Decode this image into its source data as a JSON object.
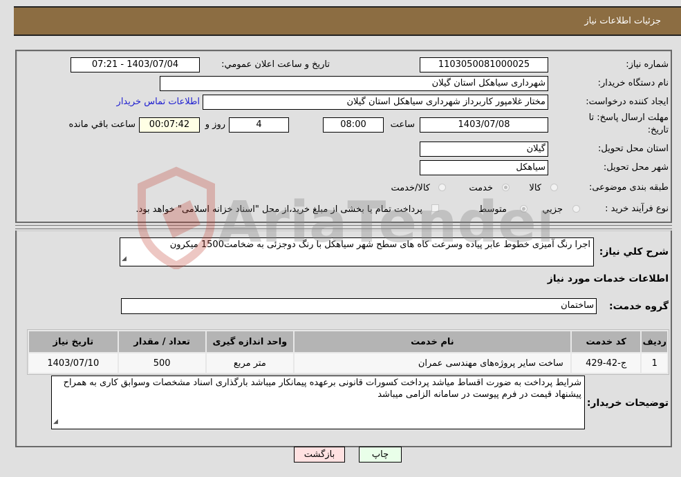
{
  "header": {
    "title": "جزئيات اطلاعات نیاز"
  },
  "fields": {
    "need_number": {
      "label": "شماره نیاز:",
      "value": "1103050081000025"
    },
    "announce_datetime": {
      "label": "تاریخ و ساعت اعلان عمومي:",
      "value": "1403/07/04 - 07:21"
    },
    "buyer_org": {
      "label": "نام دستگاه خریدار:",
      "value": "شهرداری سیاهکل استان گیلان"
    },
    "requester": {
      "label": "ایجاد کننده درخواست:",
      "value": "مختار غلامپور کاربرداز شهرداری سیاهکل استان گیلان"
    },
    "buyer_contact_link": "اطلاعات تماس خریدار",
    "deadline": {
      "label_line1": "مهلت ارسال پاسخ: تا",
      "label_line2": "تاریخ:",
      "date": "1403/07/08",
      "time_label": "ساعت",
      "time": "08:00",
      "days": "4",
      "days_label": "روز و",
      "remaining": "00:07:42",
      "remaining_label": "ساعت باقي مانده"
    },
    "delivery_province": {
      "label": "استان محل تحویل:",
      "value": "گیلان"
    },
    "delivery_city": {
      "label": "شهر محل تحویل:",
      "value": "سیاهکل"
    },
    "category": {
      "label": "طبقه بندی موضوعی:",
      "options": [
        "کالا",
        "خدمت",
        "کالا/خدمت"
      ],
      "selected": "خدمت"
    },
    "purchase_type": {
      "label": "نوع فرآیند خرید :",
      "options": [
        "جزيي",
        "متوسط"
      ],
      "selected": "متوسط",
      "treasury_note": "پرداخت تمام یا بخشی از مبلغ خرید،از محل \"اسناد خزانه اسلامی\" خواهد بود."
    }
  },
  "description": {
    "label": "شرح كلي نياز:",
    "value": "اجرا رنگ آمیزی خطوط عابر پیاده وسرعت کاه های سطح شهر سیاهکل  با رنگ دوجزئی به ضخامت1500 میکرون"
  },
  "services_section": {
    "title": "اطلاعات خدمات مورد نياز",
    "service_group": {
      "label": "گروه خدمت:",
      "value": "ساختمان"
    },
    "table": {
      "headers": [
        "ردیف",
        "کد خدمت",
        "نام خدمت",
        "واحد اندازه گیری",
        "تعداد / مقدار",
        "تاریخ نیاز"
      ],
      "rows": [
        [
          "1",
          "ج-42-429",
          "ساخت سایر پروژه‌های مهندسی عمران",
          "متر مربع",
          "500",
          "1403/07/10"
        ]
      ]
    }
  },
  "buyer_notes": {
    "label": "توضيحات خريدار:",
    "value": "شرایط پرداخت به ضورت اقساط میاشد پرداخت کسورات قانونی برعهده پیمانکار میباشد بارگذاری اسناد  مشخصات وسوابق کاری به همراح پیشنهاد قیمت در فرم پیوست در سامانه الزامی میباشد"
  },
  "buttons": {
    "print": "چاپ",
    "back": "بازگشت"
  },
  "watermark": {
    "text": "AriaTender.neT"
  }
}
